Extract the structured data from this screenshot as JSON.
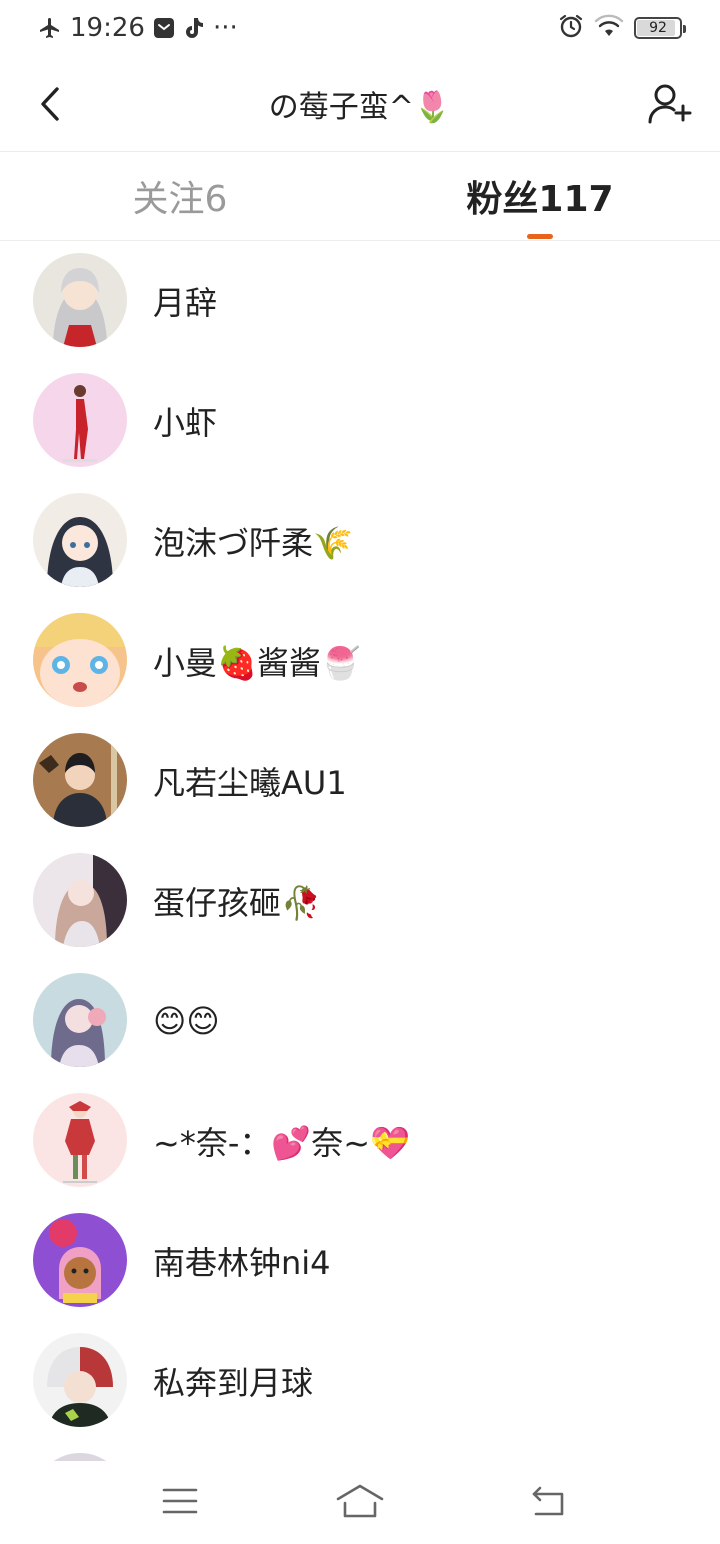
{
  "status_bar": {
    "time": "19:26",
    "more": "···",
    "battery": "92",
    "battery_level": 0.92,
    "icons": [
      "airplane-mode-icon",
      "message-icon",
      "tiktok-icon",
      "alarm-icon",
      "wifi-icon",
      "battery-icon"
    ]
  },
  "header": {
    "title": "の莓子蛮^🌷",
    "back_icon": "back-arrow-icon",
    "action_icon": "add-user-icon"
  },
  "tabs": [
    {
      "label": "关注6",
      "active": false
    },
    {
      "label": "粉丝117",
      "active": true
    }
  ],
  "colors": {
    "accent": "#e8641b",
    "inactive_tab": "#9a9a9a",
    "text": "#222222"
  },
  "followers": [
    {
      "name": "月辞"
    },
    {
      "name": "小虾"
    },
    {
      "name": "泡沫づ阡柔🌾"
    },
    {
      "name": "小曼🍓酱酱🍧"
    },
    {
      "name": "凡若尘曦AU1"
    },
    {
      "name": "蛋仔孩砸🥀"
    },
    {
      "name": "😊😊"
    },
    {
      "name": "~*奈-：💕奈~💝"
    },
    {
      "name": "南巷林钟ni4"
    },
    {
      "name": "私奔到月球"
    }
  ],
  "system_nav": {
    "icons": [
      "menu-icon",
      "home-icon",
      "back-icon"
    ]
  }
}
